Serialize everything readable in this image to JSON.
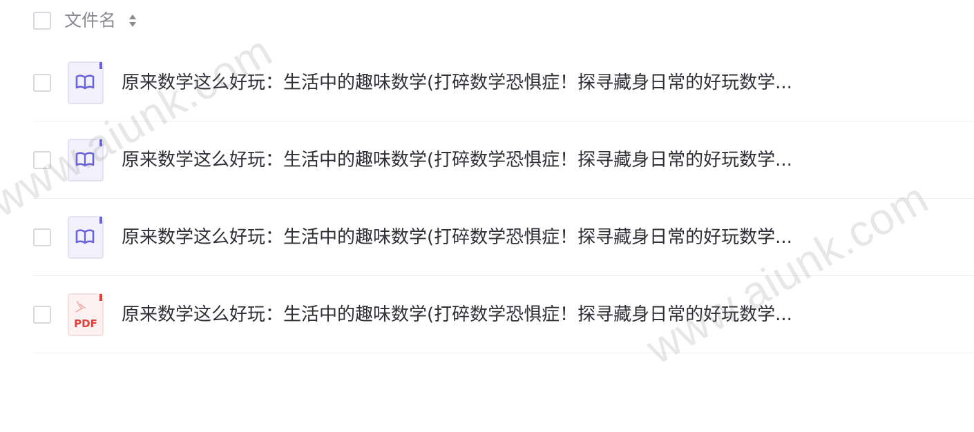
{
  "header": {
    "column_label": "文件名"
  },
  "files": [
    {
      "name": "原来数学这么好玩：生活中的趣味数学(打碎数学恐惧症！探寻藏身日常的好玩数学...",
      "type": "epub",
      "icon": "book-icon"
    },
    {
      "name": "原来数学这么好玩：生活中的趣味数学(打碎数学恐惧症！探寻藏身日常的好玩数学...",
      "type": "epub",
      "icon": "book-icon"
    },
    {
      "name": "原来数学这么好玩：生活中的趣味数学(打碎数学恐惧症！探寻藏身日常的好玩数学...",
      "type": "epub",
      "icon": "book-icon"
    },
    {
      "name": "原来数学这么好玩：生活中的趣味数学(打碎数学恐惧症！探寻藏身日常的好玩数学...",
      "type": "pdf",
      "icon": "pdf-icon",
      "icon_label": "PDF"
    }
  ],
  "watermark": {
    "text": "www.aiunk.com"
  },
  "colors": {
    "epub_accent": "#6a63d8",
    "pdf_accent": "#e0403a"
  }
}
